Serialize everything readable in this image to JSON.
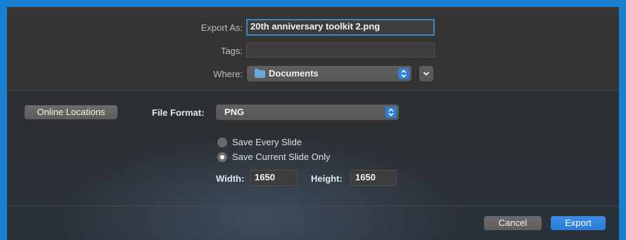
{
  "export_as": {
    "label": "Export As:",
    "value": "20th anniversary toolkit 2.png"
  },
  "tags": {
    "label": "Tags:",
    "value": ""
  },
  "where": {
    "label": "Where:",
    "value": "Documents",
    "stepper_icon": "up-down-chevron-icon",
    "expand_icon": "chevron-down-icon"
  },
  "online_locations_label": "Online Locations",
  "file_format": {
    "label": "File Format:",
    "value": "PNG"
  },
  "slide_options": [
    {
      "label": "Save Every Slide",
      "selected": false
    },
    {
      "label": "Save Current Slide Only",
      "selected": true
    }
  ],
  "width": {
    "label": "Width:",
    "value": "1650"
  },
  "height": {
    "label": "Height:",
    "value": "1650"
  },
  "buttons": {
    "cancel": "Cancel",
    "export": "Export"
  },
  "colors": {
    "accent": "#2e7fd8",
    "window_bg": "#1b7fd0"
  }
}
